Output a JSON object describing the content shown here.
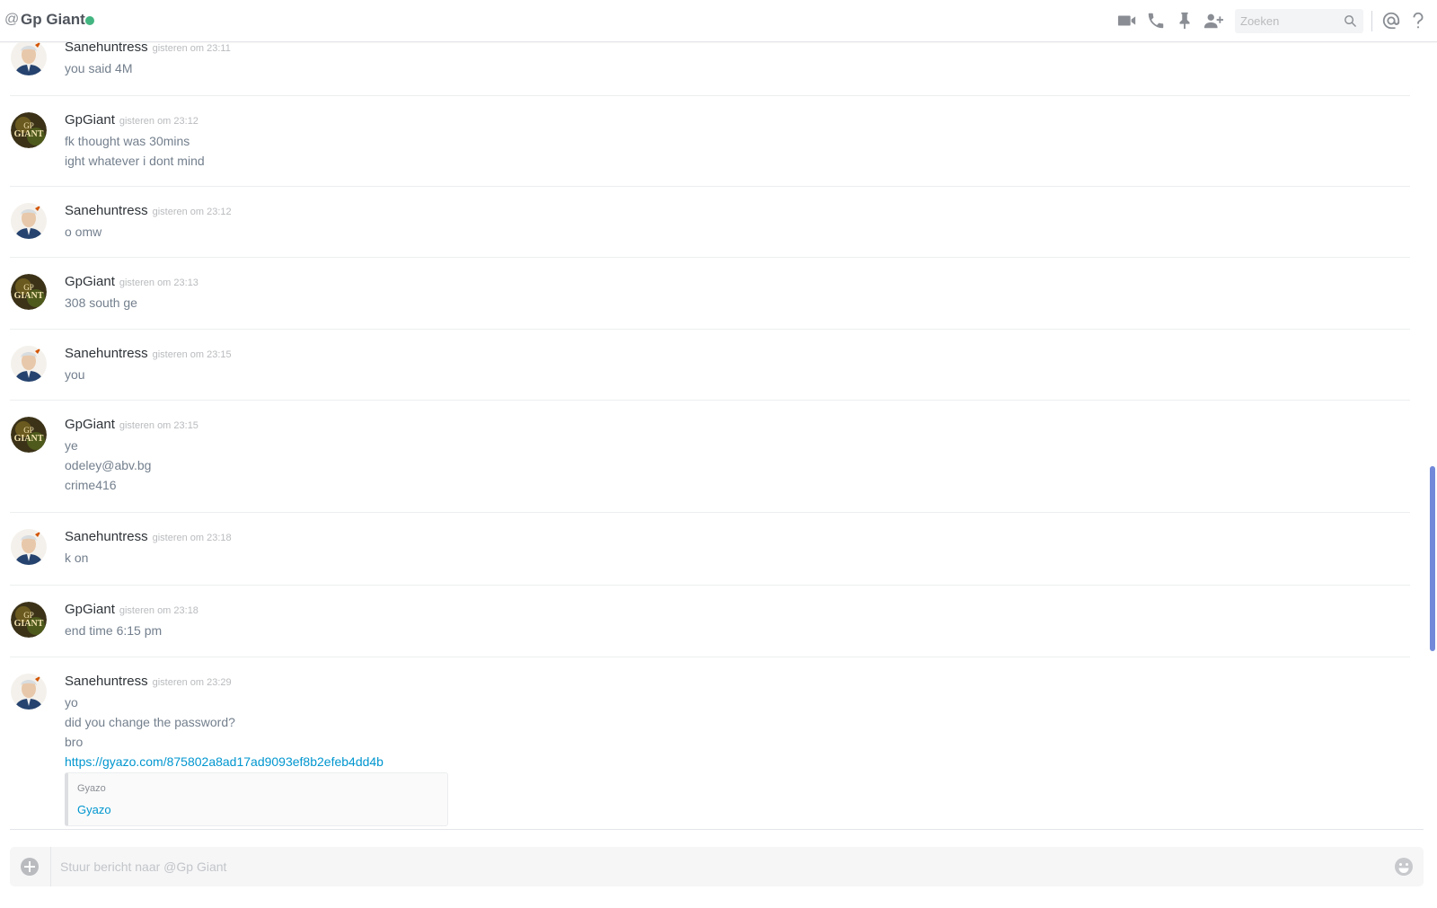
{
  "header": {
    "at_symbol": "@",
    "channel_name": "Gp Giant",
    "status_color": "#43b581",
    "icons": [
      "video-call-icon",
      "voice-call-icon",
      "pin-icon",
      "add-friend-icon",
      "mention-icon",
      "help-icon"
    ],
    "search": {
      "placeholder": "Zoeken"
    }
  },
  "messages": [
    {
      "author": "Sanehuntress",
      "timestamp": "gisteren om 23:11",
      "lines": [
        "you said 4M"
      ]
    },
    {
      "author": "GpGiant",
      "timestamp": "gisteren om 23:12",
      "lines": [
        "fk thought was 30mins",
        "ight whatever i dont mind"
      ]
    },
    {
      "author": "Sanehuntress",
      "timestamp": "gisteren om 23:12",
      "lines": [
        "o omw"
      ]
    },
    {
      "author": "GpGiant",
      "timestamp": "gisteren om 23:13",
      "lines": [
        "308 south ge"
      ]
    },
    {
      "author": "Sanehuntress",
      "timestamp": "gisteren om 23:15",
      "lines": [
        "you"
      ]
    },
    {
      "author": "GpGiant",
      "timestamp": "gisteren om 23:15",
      "lines": [
        "ye",
        "odeley@abv.bg",
        "crime416"
      ]
    },
    {
      "author": "Sanehuntress",
      "timestamp": "gisteren om 23:18",
      "lines": [
        "k on"
      ]
    },
    {
      "author": "GpGiant",
      "timestamp": "gisteren om 23:18",
      "lines": [
        "end time 6:15 pm"
      ]
    },
    {
      "author": "Sanehuntress",
      "timestamp": "gisteren om 23:29",
      "lines": [
        "yo",
        "did you change the password?",
        "bro"
      ],
      "link": "https://gyazo.com/875802a8ad17ad9093ef8b2efeb4dd4b",
      "embed": {
        "provider": "Gyazo",
        "title": "Gyazo"
      }
    }
  ],
  "avatars": {
    "gpgiant_text_top": "GP",
    "gpgiant_text_bottom": "GIANT"
  },
  "composer": {
    "placeholder": "Stuur bericht naar @Gp Giant"
  },
  "colors": {
    "accent": "#7289da",
    "link": "#0096cf",
    "online": "#43b581"
  }
}
